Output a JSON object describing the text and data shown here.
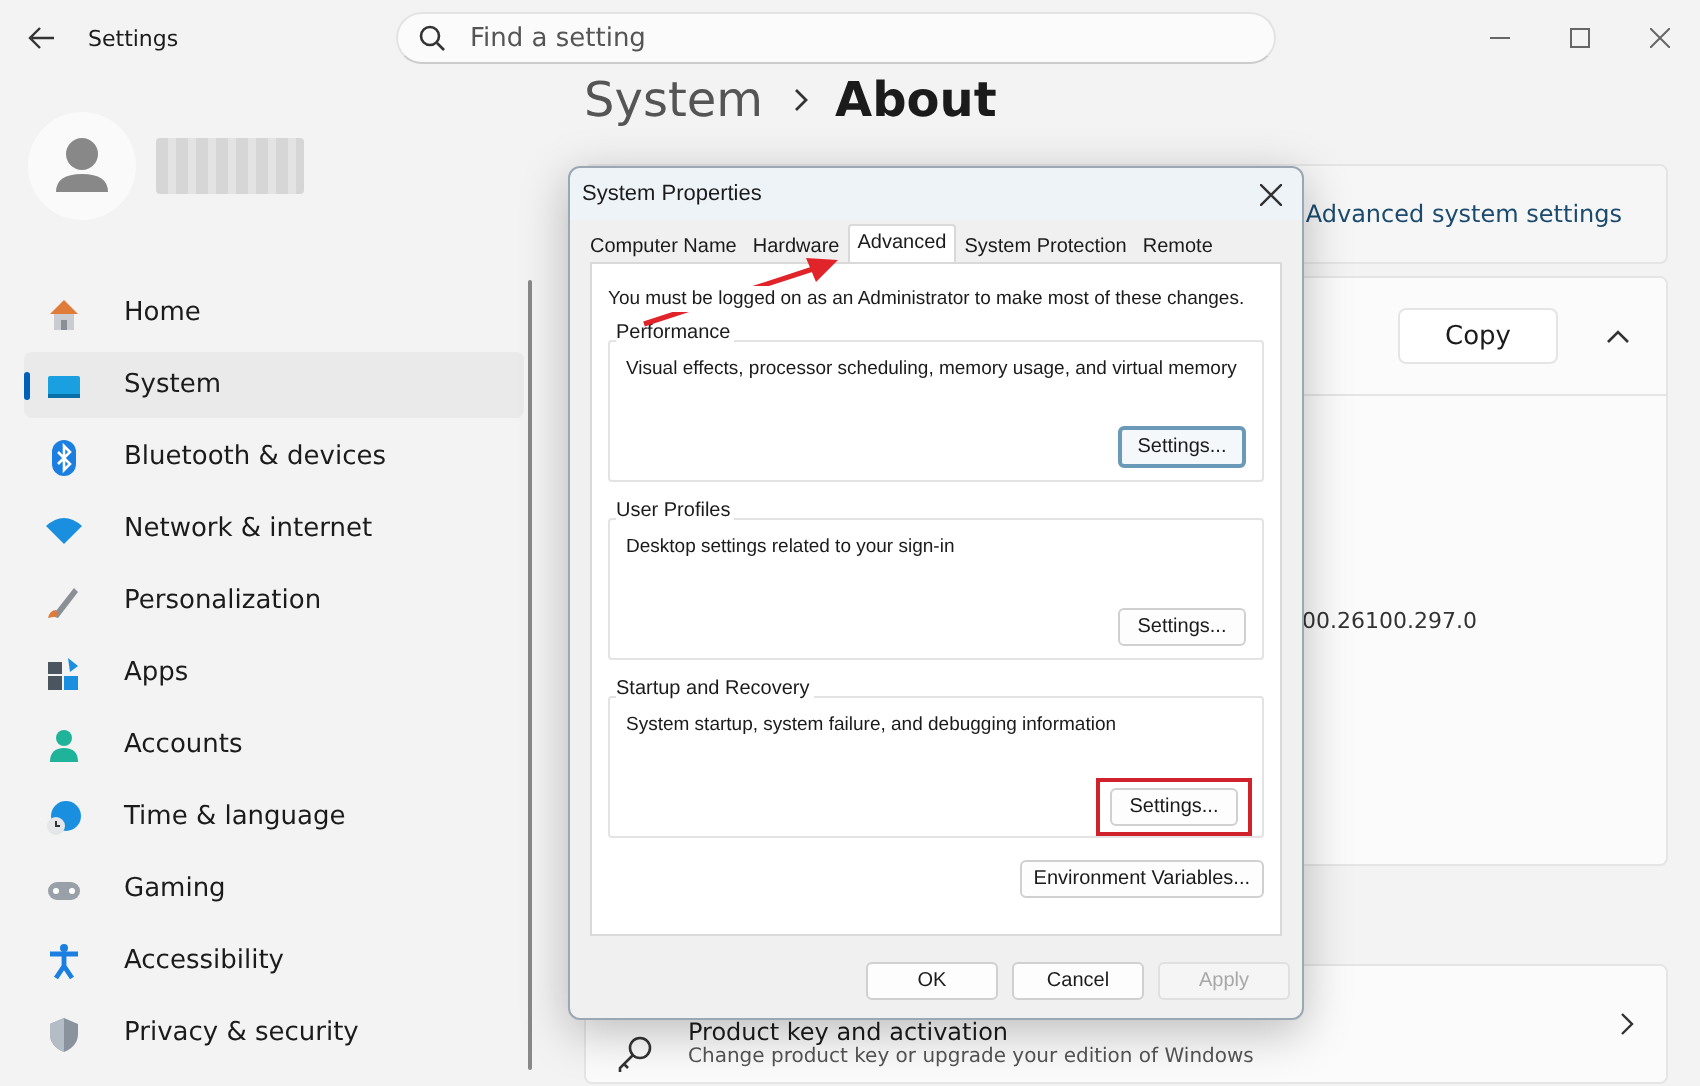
{
  "window": {
    "title": "Settings"
  },
  "search": {
    "placeholder": "Find a setting"
  },
  "sidebar": {
    "items": [
      {
        "label": "Home",
        "selected": false
      },
      {
        "label": "System",
        "selected": true
      },
      {
        "label": "Bluetooth & devices",
        "selected": false
      },
      {
        "label": "Network & internet",
        "selected": false
      },
      {
        "label": "Personalization",
        "selected": false
      },
      {
        "label": "Apps",
        "selected": false
      },
      {
        "label": "Accounts",
        "selected": false
      },
      {
        "label": "Time & language",
        "selected": false
      },
      {
        "label": "Gaming",
        "selected": false
      },
      {
        "label": "Accessibility",
        "selected": false
      },
      {
        "label": "Privacy & security",
        "selected": false
      }
    ]
  },
  "breadcrumb": {
    "parent": "System",
    "current": "About"
  },
  "main": {
    "related_link": "Advanced system settings",
    "copy_button": "Copy",
    "expanded": true,
    "version_fragment": "00.26100.297.0",
    "product_key": {
      "title": "Product key and activation",
      "subtitle": "Change product key or upgrade your edition of Windows"
    }
  },
  "dialog": {
    "title": "System Properties",
    "tabs": [
      {
        "label": "Computer Name",
        "selected": false
      },
      {
        "label": "Hardware",
        "selected": false
      },
      {
        "label": "Advanced",
        "selected": true
      },
      {
        "label": "System Protection",
        "selected": false
      },
      {
        "label": "Remote",
        "selected": false
      }
    ],
    "notice": "You must be logged on as an Administrator to make most of these changes.",
    "groups": [
      {
        "title": "Performance",
        "description": "Visual effects, processor scheduling, memory usage, and virtual memory",
        "button": "Settings...",
        "focused": true,
        "highlighted": false
      },
      {
        "title": "User Profiles",
        "description": "Desktop settings related to your sign-in",
        "button": "Settings...",
        "focused": false,
        "highlighted": false
      },
      {
        "title": "Startup and Recovery",
        "description": "System startup, system failure, and debugging information",
        "button": "Settings...",
        "focused": false,
        "highlighted": true
      }
    ],
    "env_button": "Environment Variables...",
    "buttons": [
      {
        "label": "OK",
        "disabled": false
      },
      {
        "label": "Cancel",
        "disabled": false
      },
      {
        "label": "Apply",
        "disabled": true
      }
    ]
  }
}
